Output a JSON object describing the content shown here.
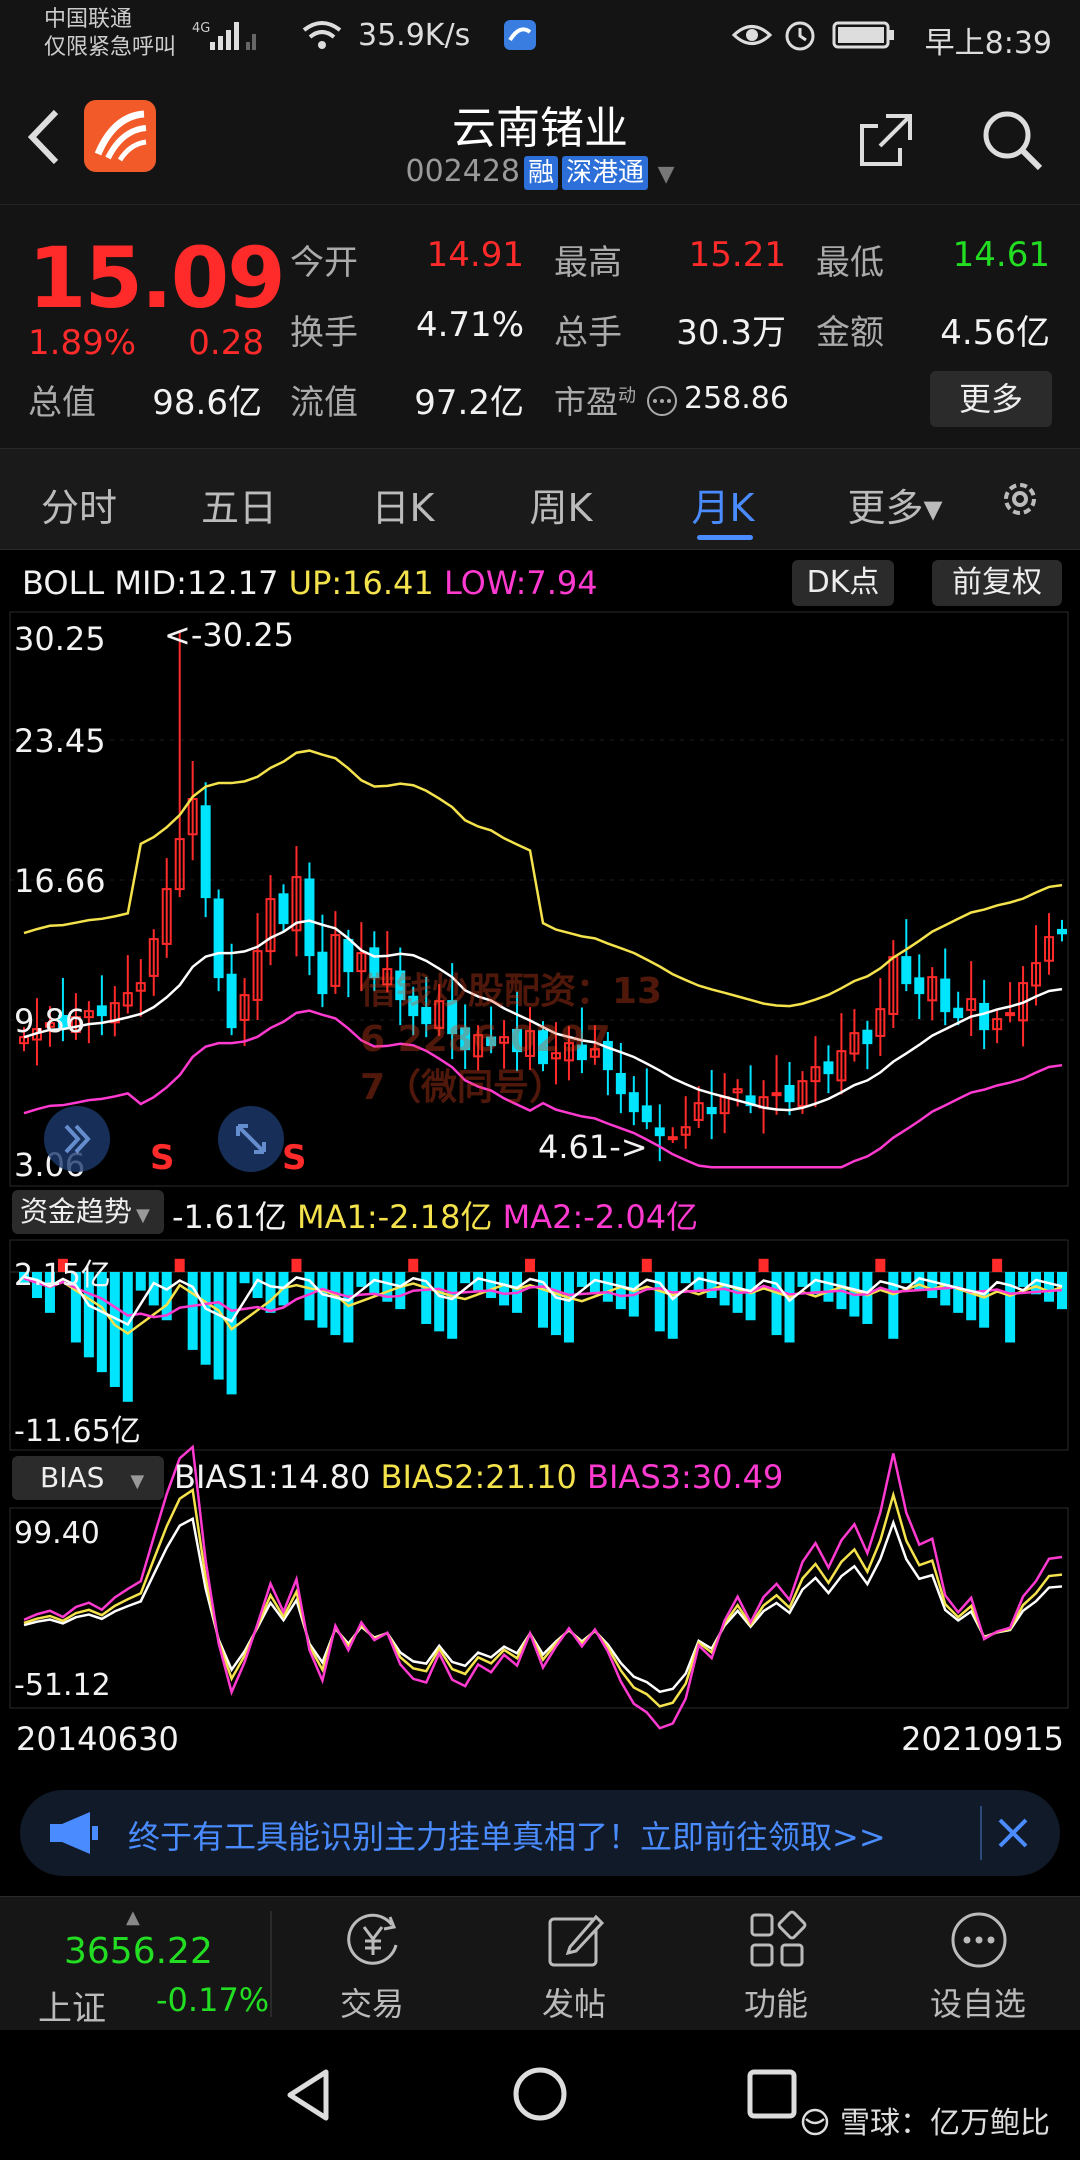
{
  "status": {
    "carrier_line1": "中国联通",
    "carrier_line2": "仅限紧急呼叫",
    "net_speed": "35.9K/s",
    "time": "早上8:39"
  },
  "header": {
    "name": "云南锗业",
    "code": "002428",
    "badge1": "融",
    "badge2": "深港通"
  },
  "quote": {
    "price": "15.09",
    "change_pct": "1.89%",
    "change": "0.28",
    "open_label": "今开",
    "open": "14.91",
    "high_label": "最高",
    "high": "15.21",
    "low_label": "最低",
    "low": "14.61",
    "turnover_label": "换手",
    "turnover": "4.71%",
    "volume_label": "总手",
    "volume": "30.3万",
    "amount_label": "金额",
    "amount": "4.56亿",
    "total_cap_label": "总值",
    "total_cap": "98.6亿",
    "float_cap_label": "流值",
    "float_cap": "97.2亿",
    "pe_label": "市盈",
    "pe_sup": "动",
    "pe": "258.86",
    "more_label": "更多"
  },
  "tabs": [
    {
      "label": "分时"
    },
    {
      "label": "五日"
    },
    {
      "label": "日K"
    },
    {
      "label": "周K"
    },
    {
      "label": "月K"
    },
    {
      "label": "更多▾"
    }
  ],
  "boll": {
    "mid": "BOLL MID:12.17",
    "up": "UP:16.41",
    "low": "LOW:7.94",
    "dk_label": "DK点",
    "adj_label": "前复权"
  },
  "price_axis": [
    "30.25",
    "23.45",
    "16.66",
    "9.86",
    "3.06"
  ],
  "markers": {
    "max": "<-30.25",
    "min": "4.61->",
    "s1": "S",
    "s2": "S"
  },
  "watermark_text": [
    "借钱炒股配资：13",
    "6 2286 0297",
    "7（微同号）"
  ],
  "fund": {
    "selector": "资金趋势",
    "value": "-1.61亿",
    "ma1": "MA1:-2.18亿",
    "ma2": "MA2:-2.04亿",
    "axis_top": "2.15亿",
    "axis_bottom": "-11.65亿"
  },
  "bias": {
    "selector": "BIAS",
    "b1": "BIAS1:14.80",
    "b2": "BIAS2:21.10",
    "b3": "BIAS3:30.49",
    "axis_top": "99.40",
    "axis_bottom": "-51.12"
  },
  "dates": {
    "start": "20140630",
    "end": "20210915"
  },
  "banner": {
    "text": "终于有工具能识别主力挂单真相了！立即前往领取>>"
  },
  "bottom": {
    "index_value": "3656.22",
    "index_name": "上证",
    "index_change": "-0.17%",
    "trade": "交易",
    "post": "发帖",
    "func": "功能",
    "watch": "设自选"
  },
  "footer": {
    "brand": "雪球：亿万鲍比"
  },
  "colors": {
    "up": "#ff2a2a",
    "down": "#00e5ff",
    "mid": "#ffffff",
    "upper": "#f4e24c",
    "lower": "#ff3ad0",
    "accent": "#4a8cff"
  }
}
